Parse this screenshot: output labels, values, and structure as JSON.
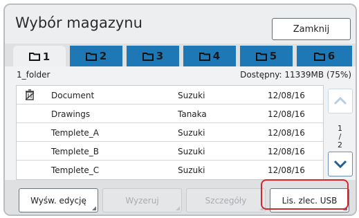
{
  "window": {
    "title": "Wybór magazynu",
    "close_label": "Zamknij"
  },
  "tabs": [
    {
      "label": "1",
      "active": true
    },
    {
      "label": "2",
      "active": false
    },
    {
      "label": "3",
      "active": false
    },
    {
      "label": "4",
      "active": false
    },
    {
      "label": "5",
      "active": false
    },
    {
      "label": "6",
      "active": false
    }
  ],
  "folder": {
    "name": "1_folder",
    "available": "Dostępny: 11339MB (75%)"
  },
  "rows": [
    {
      "name": "Document",
      "user": "Suzuki",
      "date": "12/08/16",
      "icon": "trash-icon"
    },
    {
      "name": "Drawings",
      "user": "Tanaka",
      "date": "12/08/16"
    },
    {
      "name": "Templete_A",
      "user": "Suzuki",
      "date": "12/08/16"
    },
    {
      "name": "Templete_B",
      "user": "Suzuki",
      "date": "12/08/16"
    },
    {
      "name": "Templete_C",
      "user": "Suzuki",
      "date": "12/08/16"
    }
  ],
  "pager": {
    "current": "1",
    "sep": "/",
    "total": "2"
  },
  "buttons": {
    "edit": "Wyśw. edycję",
    "reset": "Wyzeruj",
    "details": "Szczegóły",
    "usb": "Lis. zlec. USB"
  },
  "colors": {
    "tab_blue": "#1f78b6",
    "highlight_red": "#d4262c"
  }
}
